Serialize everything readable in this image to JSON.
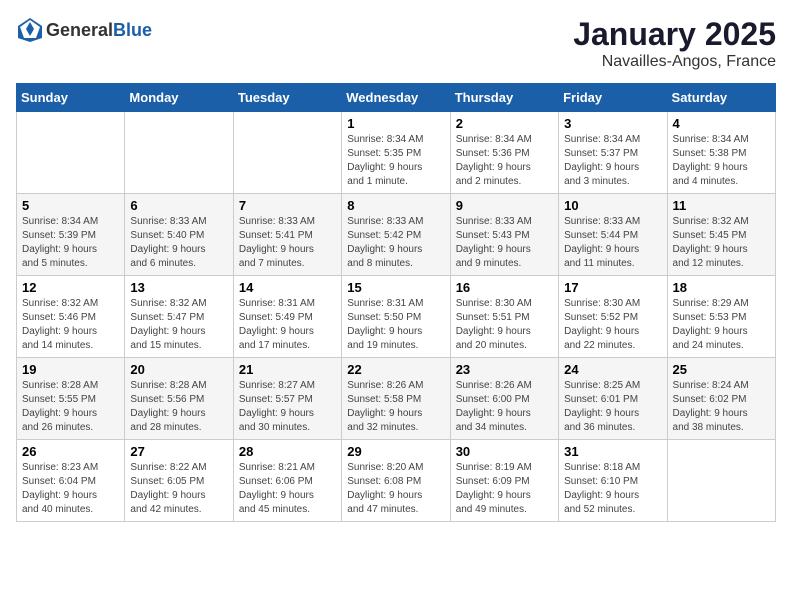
{
  "header": {
    "logo_general": "General",
    "logo_blue": "Blue",
    "month": "January 2025",
    "location": "Navailles-Angos, France"
  },
  "weekdays": [
    "Sunday",
    "Monday",
    "Tuesday",
    "Wednesday",
    "Thursday",
    "Friday",
    "Saturday"
  ],
  "weeks": [
    [
      {
        "day": "",
        "info": ""
      },
      {
        "day": "",
        "info": ""
      },
      {
        "day": "",
        "info": ""
      },
      {
        "day": "1",
        "info": "Sunrise: 8:34 AM\nSunset: 5:35 PM\nDaylight: 9 hours\nand 1 minute."
      },
      {
        "day": "2",
        "info": "Sunrise: 8:34 AM\nSunset: 5:36 PM\nDaylight: 9 hours\nand 2 minutes."
      },
      {
        "day": "3",
        "info": "Sunrise: 8:34 AM\nSunset: 5:37 PM\nDaylight: 9 hours\nand 3 minutes."
      },
      {
        "day": "4",
        "info": "Sunrise: 8:34 AM\nSunset: 5:38 PM\nDaylight: 9 hours\nand 4 minutes."
      }
    ],
    [
      {
        "day": "5",
        "info": "Sunrise: 8:34 AM\nSunset: 5:39 PM\nDaylight: 9 hours\nand 5 minutes."
      },
      {
        "day": "6",
        "info": "Sunrise: 8:33 AM\nSunset: 5:40 PM\nDaylight: 9 hours\nand 6 minutes."
      },
      {
        "day": "7",
        "info": "Sunrise: 8:33 AM\nSunset: 5:41 PM\nDaylight: 9 hours\nand 7 minutes."
      },
      {
        "day": "8",
        "info": "Sunrise: 8:33 AM\nSunset: 5:42 PM\nDaylight: 9 hours\nand 8 minutes."
      },
      {
        "day": "9",
        "info": "Sunrise: 8:33 AM\nSunset: 5:43 PM\nDaylight: 9 hours\nand 9 minutes."
      },
      {
        "day": "10",
        "info": "Sunrise: 8:33 AM\nSunset: 5:44 PM\nDaylight: 9 hours\nand 11 minutes."
      },
      {
        "day": "11",
        "info": "Sunrise: 8:32 AM\nSunset: 5:45 PM\nDaylight: 9 hours\nand 12 minutes."
      }
    ],
    [
      {
        "day": "12",
        "info": "Sunrise: 8:32 AM\nSunset: 5:46 PM\nDaylight: 9 hours\nand 14 minutes."
      },
      {
        "day": "13",
        "info": "Sunrise: 8:32 AM\nSunset: 5:47 PM\nDaylight: 9 hours\nand 15 minutes."
      },
      {
        "day": "14",
        "info": "Sunrise: 8:31 AM\nSunset: 5:49 PM\nDaylight: 9 hours\nand 17 minutes."
      },
      {
        "day": "15",
        "info": "Sunrise: 8:31 AM\nSunset: 5:50 PM\nDaylight: 9 hours\nand 19 minutes."
      },
      {
        "day": "16",
        "info": "Sunrise: 8:30 AM\nSunset: 5:51 PM\nDaylight: 9 hours\nand 20 minutes."
      },
      {
        "day": "17",
        "info": "Sunrise: 8:30 AM\nSunset: 5:52 PM\nDaylight: 9 hours\nand 22 minutes."
      },
      {
        "day": "18",
        "info": "Sunrise: 8:29 AM\nSunset: 5:53 PM\nDaylight: 9 hours\nand 24 minutes."
      }
    ],
    [
      {
        "day": "19",
        "info": "Sunrise: 8:28 AM\nSunset: 5:55 PM\nDaylight: 9 hours\nand 26 minutes."
      },
      {
        "day": "20",
        "info": "Sunrise: 8:28 AM\nSunset: 5:56 PM\nDaylight: 9 hours\nand 28 minutes."
      },
      {
        "day": "21",
        "info": "Sunrise: 8:27 AM\nSunset: 5:57 PM\nDaylight: 9 hours\nand 30 minutes."
      },
      {
        "day": "22",
        "info": "Sunrise: 8:26 AM\nSunset: 5:58 PM\nDaylight: 9 hours\nand 32 minutes."
      },
      {
        "day": "23",
        "info": "Sunrise: 8:26 AM\nSunset: 6:00 PM\nDaylight: 9 hours\nand 34 minutes."
      },
      {
        "day": "24",
        "info": "Sunrise: 8:25 AM\nSunset: 6:01 PM\nDaylight: 9 hours\nand 36 minutes."
      },
      {
        "day": "25",
        "info": "Sunrise: 8:24 AM\nSunset: 6:02 PM\nDaylight: 9 hours\nand 38 minutes."
      }
    ],
    [
      {
        "day": "26",
        "info": "Sunrise: 8:23 AM\nSunset: 6:04 PM\nDaylight: 9 hours\nand 40 minutes."
      },
      {
        "day": "27",
        "info": "Sunrise: 8:22 AM\nSunset: 6:05 PM\nDaylight: 9 hours\nand 42 minutes."
      },
      {
        "day": "28",
        "info": "Sunrise: 8:21 AM\nSunset: 6:06 PM\nDaylight: 9 hours\nand 45 minutes."
      },
      {
        "day": "29",
        "info": "Sunrise: 8:20 AM\nSunset: 6:08 PM\nDaylight: 9 hours\nand 47 minutes."
      },
      {
        "day": "30",
        "info": "Sunrise: 8:19 AM\nSunset: 6:09 PM\nDaylight: 9 hours\nand 49 minutes."
      },
      {
        "day": "31",
        "info": "Sunrise: 8:18 AM\nSunset: 6:10 PM\nDaylight: 9 hours\nand 52 minutes."
      },
      {
        "day": "",
        "info": ""
      }
    ]
  ]
}
